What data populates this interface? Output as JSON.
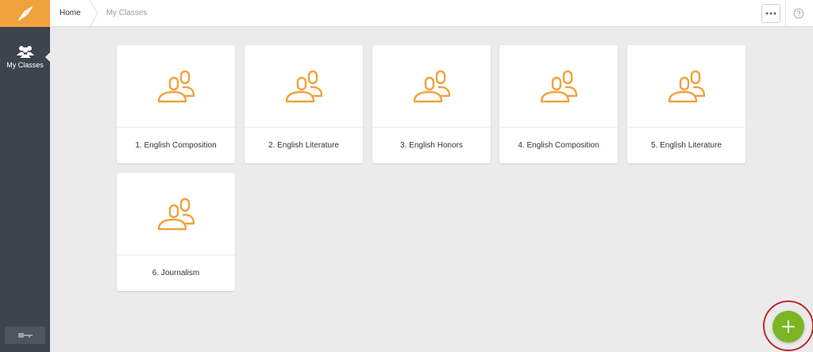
{
  "sidebar": {
    "logo_icon": "compass-logo-icon",
    "items": [
      {
        "label": "My Classes",
        "icon": "users-icon"
      }
    ],
    "bottom_button_icon": "key-icon"
  },
  "header": {
    "breadcrumb": {
      "home": "Home",
      "current": "My Classes"
    },
    "more_icon": "ellipsis-icon",
    "help_icon": "help-icon"
  },
  "classes": [
    {
      "title": "1. English Composition"
    },
    {
      "title": "2. English Literature"
    },
    {
      "title": "3. English Honors"
    },
    {
      "title": "4. English Composition"
    },
    {
      "title": "5. English Literature"
    },
    {
      "title": "6. Journalism"
    }
  ],
  "fab": {
    "icon": "plus-icon"
  },
  "colors": {
    "sidebar_bg": "#3c444d",
    "logo_bg": "#f0a23d",
    "card_icon": "#f0a23d",
    "fab_bg": "#7cb524",
    "highlight_ring": "#c0272d",
    "page_bg": "#ebebeb"
  }
}
